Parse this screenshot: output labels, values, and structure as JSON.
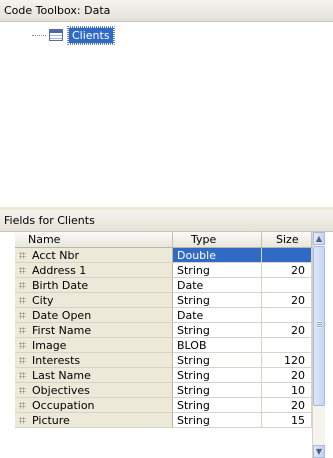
{
  "top_panel": {
    "title": "Code Toolbox: Data"
  },
  "tree": {
    "items": [
      {
        "label": "Clients",
        "icon": "table-icon",
        "selected": true
      }
    ]
  },
  "fields_panel": {
    "title": "Fields for Clients"
  },
  "grid": {
    "columns": [
      "Name",
      "Type",
      "Size"
    ],
    "rows": [
      {
        "name": "Acct Nbr",
        "type": "Double",
        "size": "",
        "selected": true
      },
      {
        "name": "Address 1",
        "type": "String",
        "size": "20"
      },
      {
        "name": "Birth Date",
        "type": "Date",
        "size": ""
      },
      {
        "name": "City",
        "type": "String",
        "size": "20"
      },
      {
        "name": "Date Open",
        "type": "Date",
        "size": ""
      },
      {
        "name": "First Name",
        "type": "String",
        "size": "20"
      },
      {
        "name": "Image",
        "type": "BLOB",
        "size": ""
      },
      {
        "name": "Interests",
        "type": "String",
        "size": "120"
      },
      {
        "name": "Last Name",
        "type": "String",
        "size": "20"
      },
      {
        "name": "Objectives",
        "type": "String",
        "size": "10"
      },
      {
        "name": "Occupation",
        "type": "String",
        "size": "20"
      },
      {
        "name": "Picture",
        "type": "String",
        "size": "15"
      }
    ]
  },
  "colors": {
    "selection": "#316ac5",
    "header_bg": "#ece9d8"
  }
}
